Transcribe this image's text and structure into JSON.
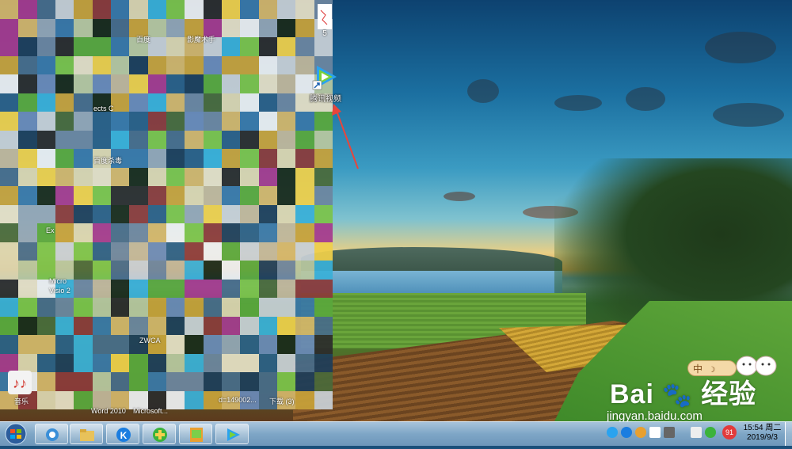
{
  "desktop": {
    "shortcuts": [
      {
        "label": "腾讯视频",
        "icon": "tencent-video-icon"
      },
      {
        "label": "5",
        "icon": "document-icon"
      }
    ],
    "blurred_labels": [
      "百度",
      "影魔术手",
      "百度杀毒",
      "Micro",
      "Visio 2",
      "ZWCA",
      "音乐",
      "Word 2010",
      "Microsoft...",
      "d=149002...",
      "下载 (3)",
      "ects C",
      "Ex"
    ]
  },
  "watermark": {
    "brand": "Bai",
    "brand_cn": "经验",
    "url": "jingyan.baidu.com"
  },
  "ime": {
    "label": "中"
  },
  "taskbar": {
    "pinned": [
      "browser-icon",
      "file-explorer-icon",
      "kugou-icon",
      "qihoo-security-icon",
      "image-viewer-icon",
      "tencent-video-icon"
    ],
    "tray_badge": "91",
    "time": "15:54 周二",
    "date": "2019/9/3"
  },
  "colors": {
    "arrow": "#e8453c",
    "taskbar": "#7ea6c6",
    "badge": "#e23b3b"
  }
}
